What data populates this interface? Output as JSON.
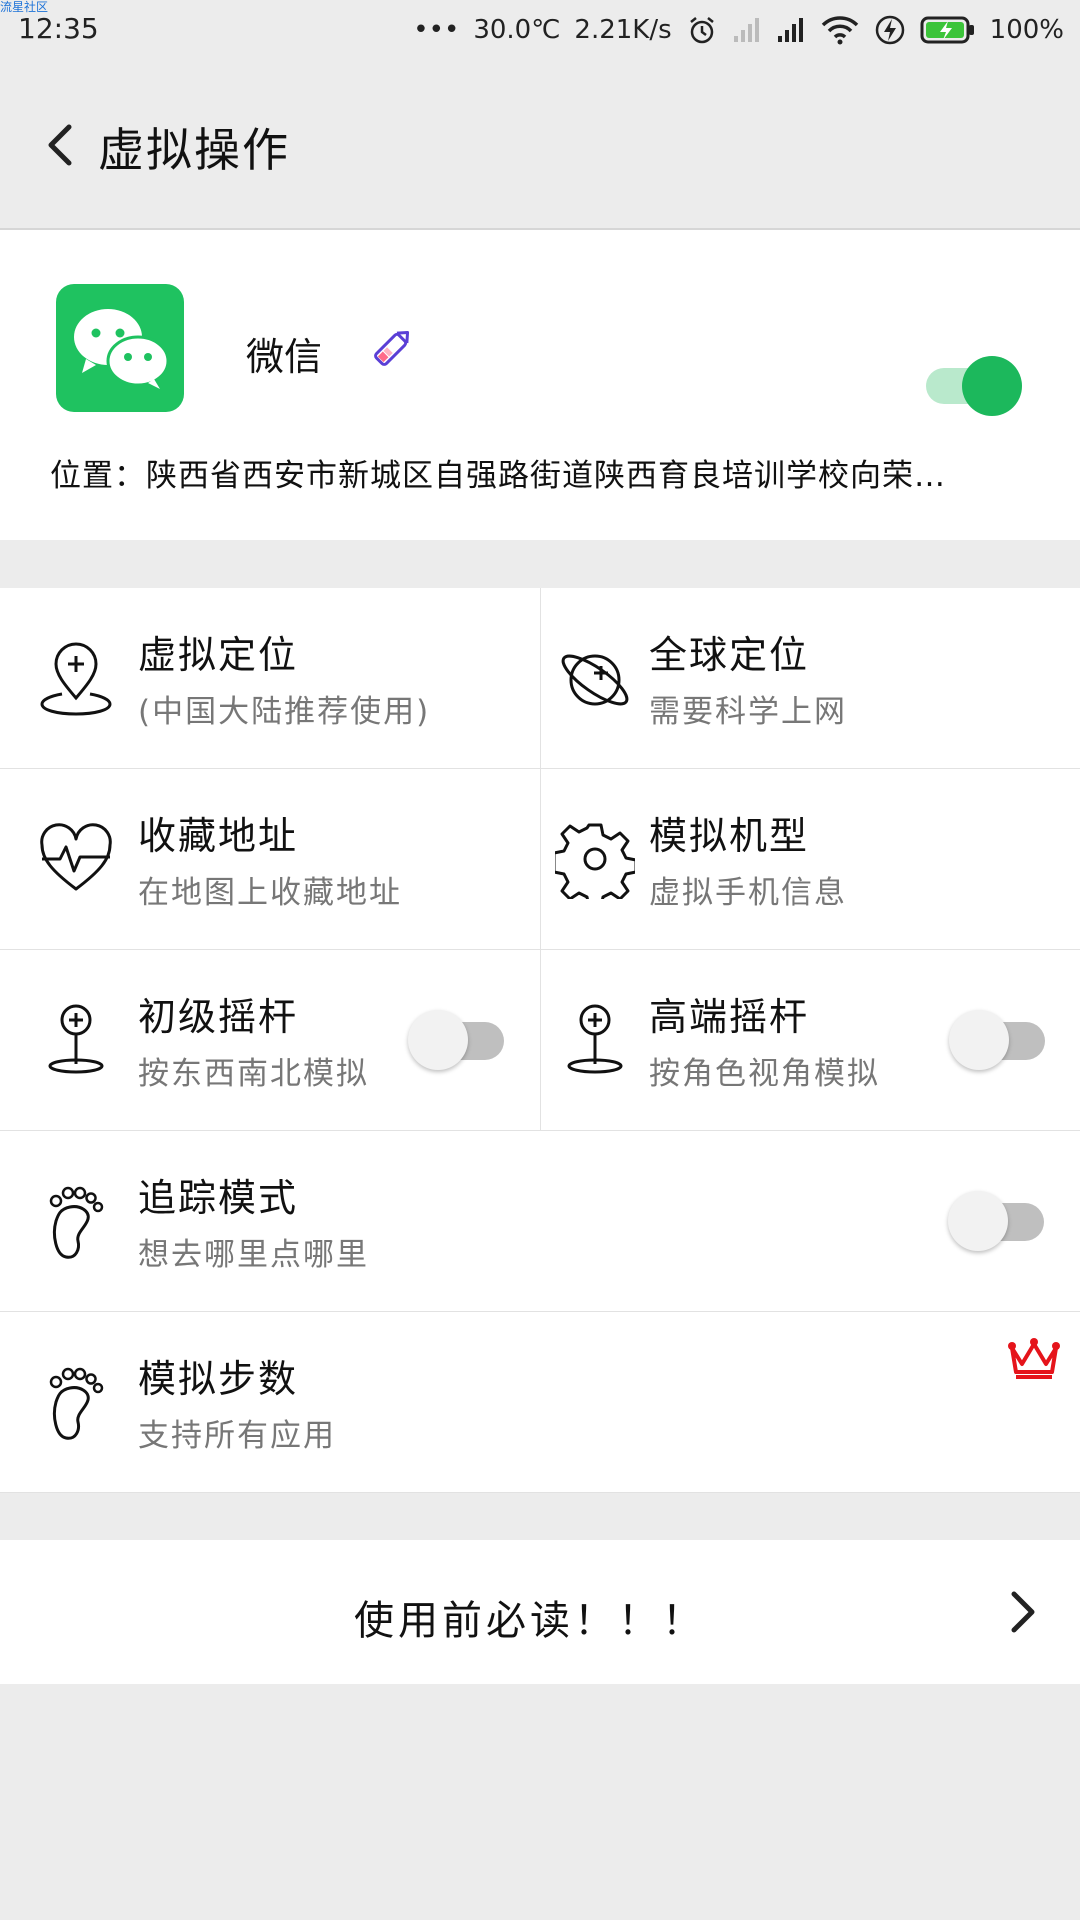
{
  "status_bar": {
    "watermark": "流星社区",
    "time": "12:35",
    "dots": "•••",
    "temperature": "30.0℃",
    "speed": "2.21K/s",
    "battery": "100%",
    "icons": [
      "alarm-icon",
      "signal-icon",
      "signal-icon",
      "wifi-icon",
      "charging-icon",
      "battery-icon"
    ]
  },
  "header": {
    "back_icon": "chevron-left-icon",
    "title": "虚拟操作"
  },
  "app_card": {
    "app_name": "微信",
    "app_icon": "wechat-icon",
    "edit_icon": "pencil-icon",
    "enabled": true,
    "location": "位置：陕西省西安市新城区自强路街道陕西育良培训学校向荣…"
  },
  "features": [
    {
      "title": "虚拟定位",
      "subtitle": "(中国大陆推荐使用)",
      "icon": "location-pin-plus-icon"
    },
    {
      "title": "全球定位",
      "subtitle": "需要科学上网",
      "icon": "planet-icon"
    },
    {
      "title": "收藏地址",
      "subtitle": "在地图上收藏地址",
      "icon": "heart-pulse-icon"
    },
    {
      "title": "模拟机型",
      "subtitle": "虚拟手机信息",
      "icon": "gear-icon"
    },
    {
      "title": "初级摇杆",
      "subtitle": "按东西南北模拟",
      "icon": "joystick-icon",
      "toggle": false
    },
    {
      "title": "高端摇杆",
      "subtitle": "按角色视角模拟",
      "icon": "joystick-icon",
      "toggle": false
    },
    {
      "title": "追踪模式",
      "subtitle": "想去哪里点哪里",
      "icon": "footprint-icon",
      "toggle": false
    },
    {
      "title": "模拟步数",
      "subtitle": "支持所有应用",
      "icon": "footprint-icon",
      "badge": "crown-icon"
    }
  ],
  "notice": {
    "label": "使用前必读！！！",
    "arrow_icon": "chevron-right-icon"
  },
  "colors": {
    "accent_green": "#1cb85c",
    "wechat_green": "#1fc260",
    "crown_red": "#e5141b",
    "background": "#ececec"
  }
}
